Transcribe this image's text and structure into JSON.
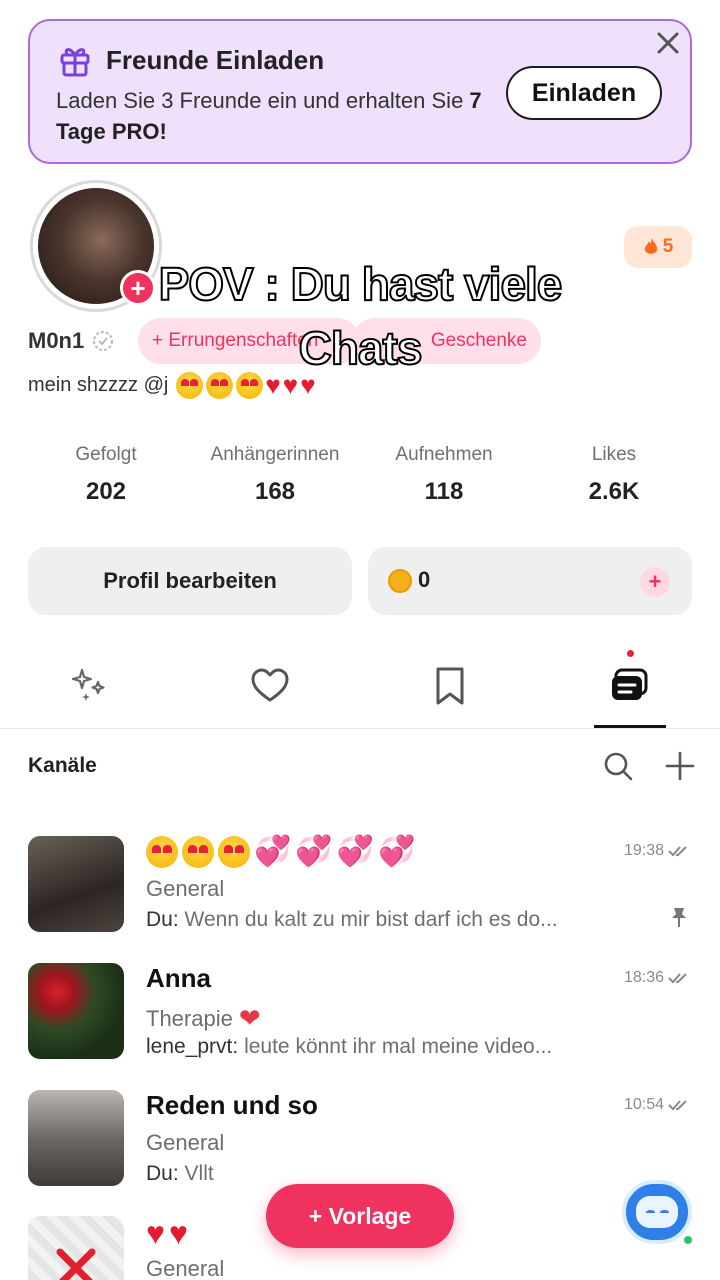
{
  "invite": {
    "title": "Freunde Einladen",
    "desc_prefix": "Laden Sie 3 Freunde ein und erhalten Sie ",
    "desc_bold": "7 Tage PRO!",
    "button_label": "Einladen"
  },
  "overlay": {
    "line1": "POV : Du hast viele",
    "line2": "Chats"
  },
  "profile": {
    "fire_count": "5",
    "username": "M0n1",
    "pill_achievements": "+ Errungenschaften",
    "pill_gifts": "Geschenke",
    "bio_text": "mein shzzzz @j"
  },
  "stats": [
    {
      "label": "Gefolgt",
      "value": "202"
    },
    {
      "label": "Anhängerinnen",
      "value": "168"
    },
    {
      "label": "Aufnehmen",
      "value": "118"
    },
    {
      "label": "Likes",
      "value": "2.6K"
    }
  ],
  "actions": {
    "edit_label": "Profil bearbeiten",
    "coins": "0",
    "coins_plus": "+"
  },
  "tabs": [
    {
      "icon": "sparkle-icon"
    },
    {
      "icon": "heart-outline-icon"
    },
    {
      "icon": "bookmark-icon"
    },
    {
      "icon": "chat-bubbles-icon",
      "active": true
    }
  ],
  "channels": {
    "title": "Kanäle",
    "items": [
      {
        "name": "",
        "sub": "General",
        "who": "Du:",
        "msg": " Wenn du kalt zu mir bist darf ich es do...",
        "time": "19:38",
        "pinned": true
      },
      {
        "name": "Anna",
        "sub": "Therapie",
        "who": "lene_prvt:",
        "msg": " leute könnt ihr mal meine video...",
        "time": "18:36"
      },
      {
        "name": "Reden und so",
        "sub": "General",
        "who": "Du:",
        "msg": " Vllt",
        "time": "10:54"
      },
      {
        "name": "",
        "sub": "General",
        "who": "",
        "msg": "",
        "time": ""
      }
    ]
  },
  "floating": {
    "vorlage_label": "+ Vorlage"
  },
  "colors": {
    "accent": "#f0325e",
    "invite_bg": "#efe0fb",
    "invite_border": "#a96be0"
  }
}
